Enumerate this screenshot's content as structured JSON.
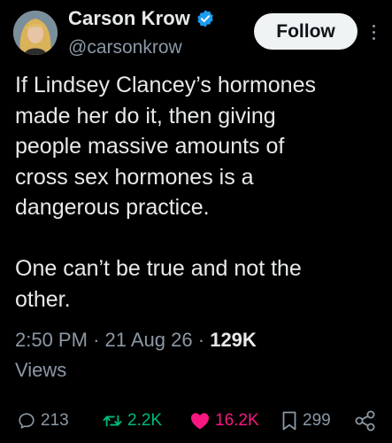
{
  "author": {
    "display_name": "Carson Krow",
    "handle": "@carsonkrow",
    "verified_color": "#1d9bf0"
  },
  "follow_button": {
    "label": "Follow"
  },
  "tweet": {
    "text": "If Lindsey Clancey’s hormones\nmade her do it, then giving\npeople massive amounts of\ncross sex hormones is a\ndangerous practice.\n\nOne can’t be true and not the\nother."
  },
  "meta": {
    "time": "2:50 PM",
    "separator": "·",
    "date": "21 Aug 26",
    "views_count": "129K",
    "views_label": "Views"
  },
  "actions": {
    "replies": "213",
    "reposts": "2.2K",
    "likes": "16.2K",
    "bookmarks": "299"
  },
  "colors": {
    "background": "#000000",
    "text": "#e7e9ea",
    "secondary": "#8b98a5",
    "repost": "#00ba7c",
    "like": "#f91880"
  },
  "icons": [
    "more-icon",
    "verified-badge-icon",
    "reply-icon",
    "repost-icon",
    "like-icon",
    "bookmark-icon",
    "share-icon"
  ]
}
